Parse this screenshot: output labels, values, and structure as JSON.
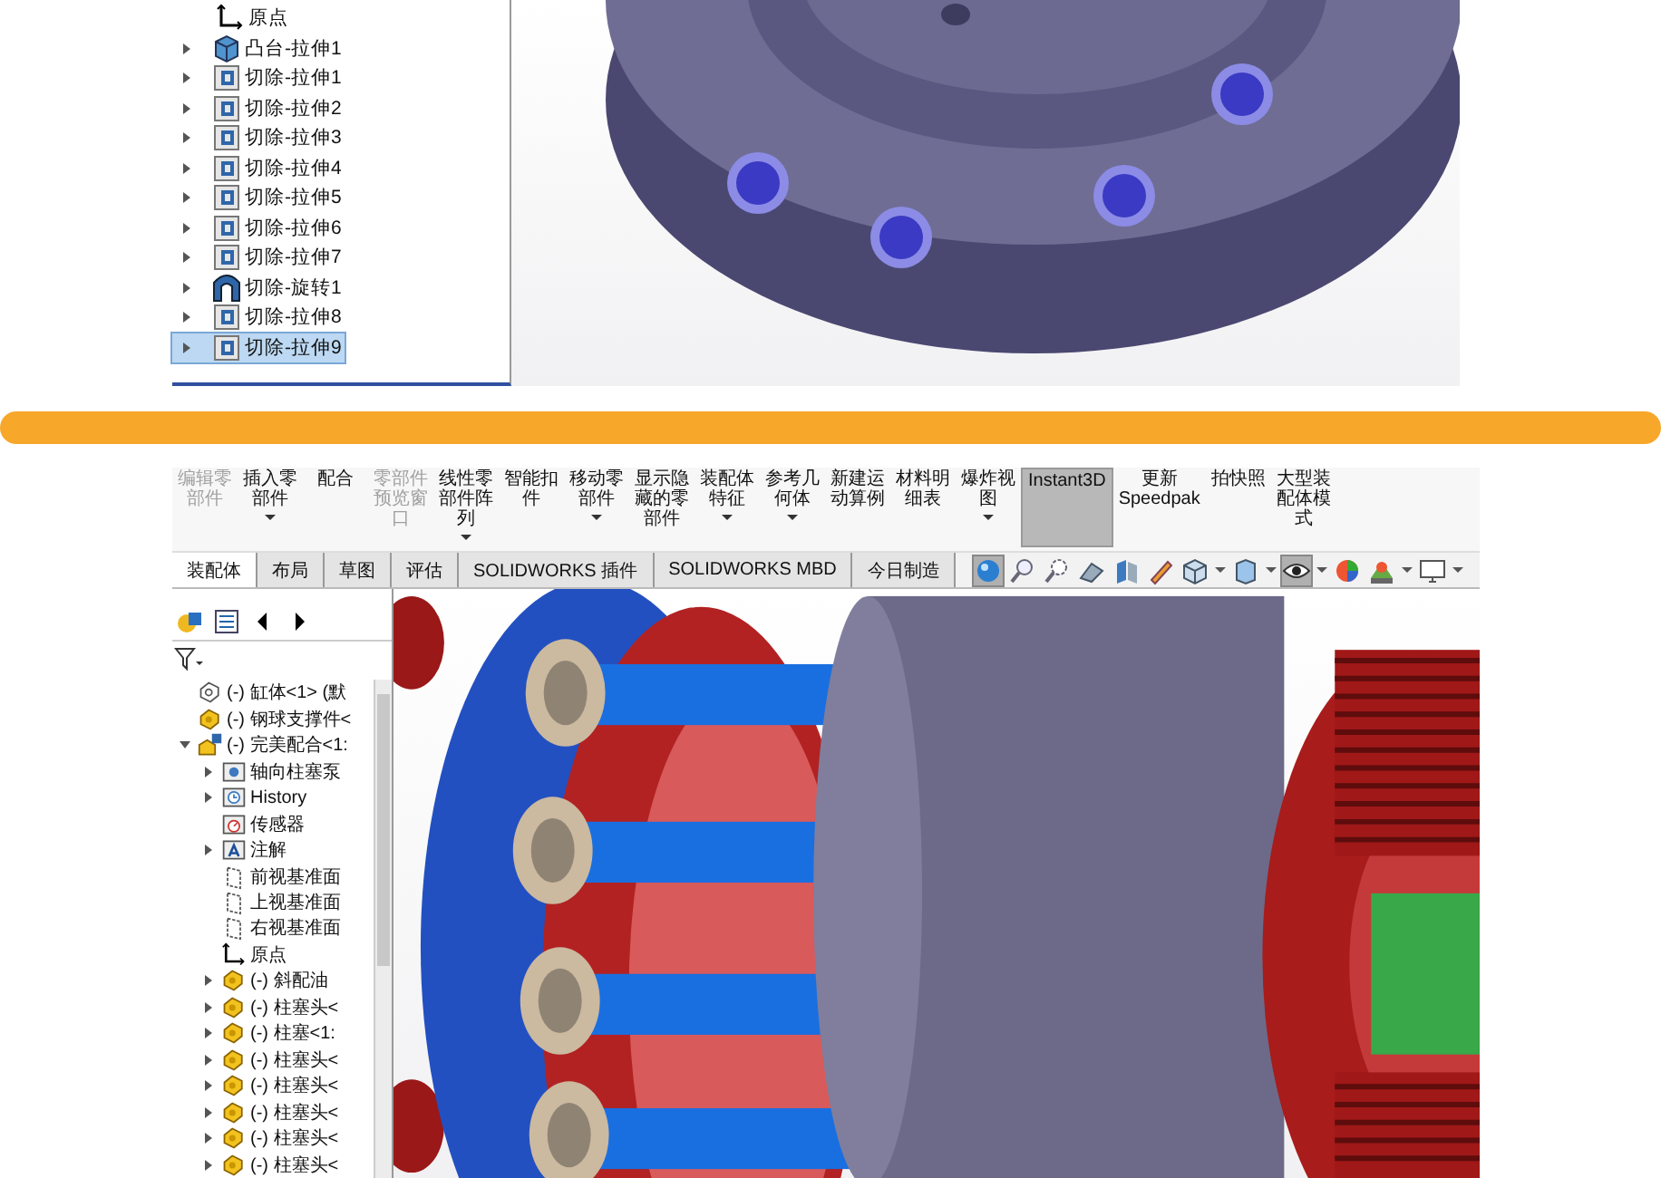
{
  "top_panel": {
    "tree": {
      "items": [
        {
          "label": "原点",
          "kind": "origin",
          "expandable": false,
          "selected": false
        },
        {
          "label": "凸台-拉伸1",
          "kind": "boss-extrude",
          "expandable": true,
          "expanded": false,
          "selected": false
        },
        {
          "label": "切除-拉伸1",
          "kind": "cut-extrude",
          "expandable": true,
          "expanded": false,
          "selected": false
        },
        {
          "label": "切除-拉伸2",
          "kind": "cut-extrude",
          "expandable": true,
          "expanded": false,
          "selected": false
        },
        {
          "label": "切除-拉伸3",
          "kind": "cut-extrude",
          "expandable": true,
          "expanded": false,
          "selected": false
        },
        {
          "label": "切除-拉伸4",
          "kind": "cut-extrude",
          "expandable": true,
          "expanded": false,
          "selected": false
        },
        {
          "label": "切除-拉伸5",
          "kind": "cut-extrude",
          "expandable": true,
          "expanded": false,
          "selected": false
        },
        {
          "label": "切除-拉伸6",
          "kind": "cut-extrude",
          "expandable": true,
          "expanded": false,
          "selected": false
        },
        {
          "label": "切除-拉伸7",
          "kind": "cut-extrude",
          "expandable": true,
          "expanded": false,
          "selected": false
        },
        {
          "label": "切除-旋转1",
          "kind": "cut-revolve",
          "expandable": true,
          "expanded": false,
          "selected": false
        },
        {
          "label": "切除-拉伸8",
          "kind": "cut-extrude",
          "expandable": true,
          "expanded": false,
          "selected": false
        },
        {
          "label": "切除-拉伸9",
          "kind": "cut-extrude",
          "expandable": true,
          "expanded": false,
          "selected": true
        }
      ]
    }
  },
  "bottom_panel": {
    "ribbon": {
      "buttons": [
        {
          "label": "编辑零部件",
          "disabled": true,
          "dropdown": false,
          "selected": false
        },
        {
          "label": "插入零部件",
          "disabled": false,
          "dropdown": true,
          "selected": false
        },
        {
          "label": "配合",
          "disabled": false,
          "dropdown": false,
          "selected": false
        },
        {
          "label": "零部件预览窗口",
          "disabled": true,
          "dropdown": false,
          "selected": false
        },
        {
          "label": "线性零部件阵列",
          "disabled": false,
          "dropdown": true,
          "selected": false
        },
        {
          "label": "智能扣件",
          "disabled": false,
          "dropdown": false,
          "selected": false
        },
        {
          "label": "移动零部件",
          "disabled": false,
          "dropdown": true,
          "selected": false
        },
        {
          "label": "显示隐藏的零部件",
          "disabled": false,
          "dropdown": false,
          "selected": false
        },
        {
          "label": "装配体特征",
          "disabled": false,
          "dropdown": true,
          "selected": false
        },
        {
          "label": "参考几何体",
          "disabled": false,
          "dropdown": true,
          "selected": false
        },
        {
          "label": "新建运动算例",
          "disabled": false,
          "dropdown": false,
          "selected": false
        },
        {
          "label": "材料明细表",
          "disabled": false,
          "dropdown": false,
          "selected": false
        },
        {
          "label": "爆炸视图",
          "disabled": false,
          "dropdown": true,
          "selected": false
        },
        {
          "label": "Instant3D",
          "disabled": false,
          "dropdown": false,
          "selected": true
        },
        {
          "label": "更新Speedpak",
          "disabled": false,
          "dropdown": false,
          "selected": false
        },
        {
          "label": "拍快照",
          "disabled": false,
          "dropdown": false,
          "selected": false
        },
        {
          "label": "大型装配体模式",
          "disabled": false,
          "dropdown": false,
          "selected": false
        }
      ]
    },
    "tabs": [
      {
        "label": "装配体",
        "selected": true
      },
      {
        "label": "布局",
        "selected": false
      },
      {
        "label": "草图",
        "selected": false
      },
      {
        "label": "评估",
        "selected": false
      },
      {
        "label": "SOLIDWORKS 插件",
        "selected": false
      },
      {
        "label": "SOLIDWORKS MBD",
        "selected": false
      },
      {
        "label": "今日制造",
        "selected": false
      }
    ],
    "view_toolbar": [
      {
        "kind": "sphere",
        "selected": true,
        "dropdown": false
      },
      {
        "kind": "zoom",
        "selected": false,
        "dropdown": false
      },
      {
        "kind": "zoom-area",
        "selected": false,
        "dropdown": false
      },
      {
        "kind": "previous-view",
        "selected": false,
        "dropdown": false
      },
      {
        "kind": "section-view",
        "selected": false,
        "dropdown": false
      },
      {
        "kind": "pen",
        "selected": false,
        "dropdown": false
      },
      {
        "kind": "view-cube",
        "selected": false,
        "dropdown": true
      },
      {
        "kind": "display-box",
        "selected": false,
        "dropdown": true
      },
      {
        "kind": "eye",
        "selected": true,
        "dropdown": true
      },
      {
        "kind": "color-wheel",
        "selected": false,
        "dropdown": false
      },
      {
        "kind": "scene",
        "selected": false,
        "dropdown": true
      },
      {
        "kind": "monitor",
        "selected": false,
        "dropdown": true
      }
    ],
    "tree": {
      "items": [
        {
          "label": "(-) 缸体<1> (默",
          "kind": "part-outline",
          "expandable": false
        },
        {
          "label": "(-) 钢球支撑件<",
          "kind": "part",
          "expandable": false
        },
        {
          "label": "(-) 完美配合<1:",
          "kind": "assembly",
          "expandable": true,
          "expanded": true,
          "children": [
            {
              "label": "轴向柱塞泵",
              "kind": "folder",
              "expandable": true,
              "expanded": false
            },
            {
              "label": "History",
              "kind": "history",
              "expandable": true,
              "expanded": false
            },
            {
              "label": "传感器",
              "kind": "sensor",
              "expandable": false
            },
            {
              "label": "注解",
              "kind": "annotation",
              "expandable": true,
              "expanded": false
            },
            {
              "label": "前视基准面",
              "kind": "plane",
              "expandable": false
            },
            {
              "label": "上视基准面",
              "kind": "plane",
              "expandable": false
            },
            {
              "label": "右视基准面",
              "kind": "plane",
              "expandable": false
            },
            {
              "label": "原点",
              "kind": "origin",
              "expandable": false
            },
            {
              "label": "(-) 斜配油",
              "kind": "part",
              "expandable": true,
              "expanded": false
            },
            {
              "label": "(-) 柱塞头<",
              "kind": "part",
              "expandable": true,
              "expanded": false
            },
            {
              "label": "(-) 柱塞<1:",
              "kind": "part",
              "expandable": true,
              "expanded": false
            },
            {
              "label": "(-) 柱塞头<",
              "kind": "part",
              "expandable": true,
              "expanded": false
            },
            {
              "label": "(-) 柱塞头<",
              "kind": "part",
              "expandable": true,
              "expanded": false
            },
            {
              "label": "(-) 柱塞头<",
              "kind": "part",
              "expandable": true,
              "expanded": false
            },
            {
              "label": "(-) 柱塞头<",
              "kind": "part",
              "expandable": true,
              "expanded": false
            },
            {
              "label": "(-) 柱塞头<",
              "kind": "part",
              "expandable": true,
              "expanded": false
            }
          ]
        }
      ]
    }
  }
}
